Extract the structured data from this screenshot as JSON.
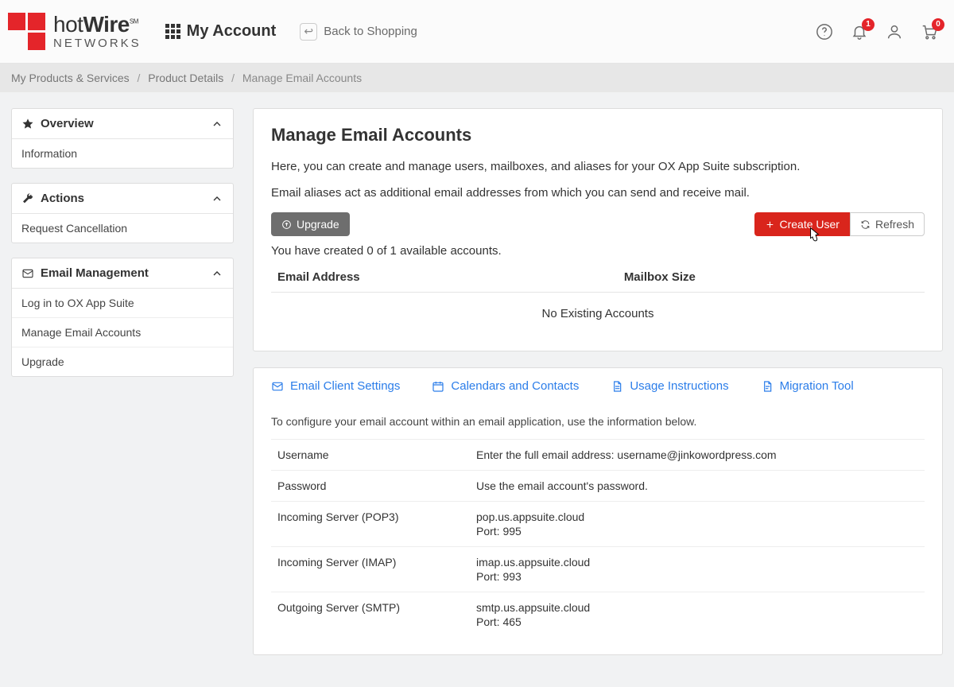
{
  "header": {
    "brand_plain": "hot",
    "brand_bold": "Wire",
    "brand_sm": "SM",
    "brand_sub": "NETWORKS",
    "my_account": "My Account",
    "back_to_shopping": "Back to Shopping",
    "notifications_badge": "1",
    "cart_badge": "0"
  },
  "breadcrumb": {
    "a": "My Products & Services",
    "b": "Product Details",
    "c": "Manage Email Accounts"
  },
  "sidebar": {
    "overview": {
      "title": "Overview",
      "items": [
        "Information"
      ]
    },
    "actions": {
      "title": "Actions",
      "items": [
        "Request Cancellation"
      ]
    },
    "email": {
      "title": "Email Management",
      "items": [
        "Log in to OX App Suite",
        "Manage Email Accounts",
        "Upgrade"
      ]
    }
  },
  "main": {
    "title": "Manage Email Accounts",
    "p1": "Here, you can create and manage users, mailboxes, and aliases for your OX App Suite subscription.",
    "p2": "Email aliases act as additional email addresses from which you can send and receive mail.",
    "upgrade_btn": "Upgrade",
    "create_user_btn": "Create User",
    "refresh_btn": "Refresh",
    "quota": "You have created 0 of 1 available accounts.",
    "th_email": "Email Address",
    "th_size": "Mailbox Size",
    "empty": "No Existing Accounts"
  },
  "tabs": {
    "t1": "Email Client Settings",
    "t2": "Calendars and Contacts",
    "t3": "Usage Instructions",
    "t4": "Migration Tool",
    "intro": "To configure your email account within an email application, use the information below.",
    "rows": [
      {
        "k": "Username",
        "v": "Enter the full email address: username@jinkowordpress.com"
      },
      {
        "k": "Password",
        "v": "Use the email account's password."
      },
      {
        "k": "Incoming Server (POP3)",
        "v": "pop.us.appsuite.cloud",
        "port": "Port: 995"
      },
      {
        "k": "Incoming Server (IMAP)",
        "v": "imap.us.appsuite.cloud",
        "port": "Port: 993"
      },
      {
        "k": "Outgoing Server (SMTP)",
        "v": "smtp.us.appsuite.cloud",
        "port": "Port: 465"
      }
    ]
  }
}
